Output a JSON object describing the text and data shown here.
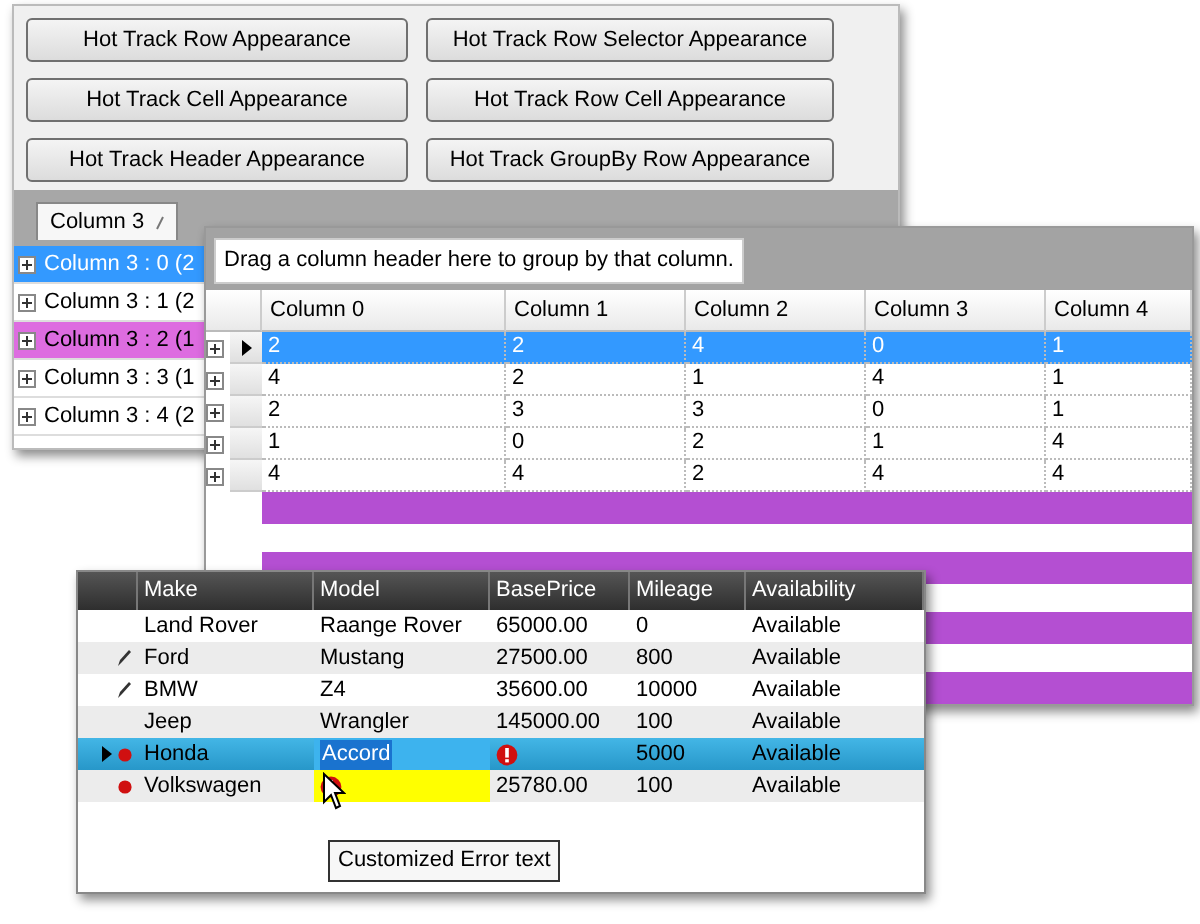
{
  "button_panel": {
    "buttons": [
      "Hot Track Row Appearance",
      "Hot Track Row Selector Appearance",
      "Hot Track Cell Appearance",
      "Hot Track Row Cell Appearance",
      "Hot Track Header Appearance",
      "Hot Track GroupBy Row Appearance"
    ]
  },
  "group_panel": {
    "group_chip": "Column 3",
    "group_rows": [
      {
        "text": "Column 3 : 0 (2",
        "selected": true,
        "hot_tracked": false
      },
      {
        "text": "Column 3 : 1 (2",
        "selected": false,
        "hot_tracked": false
      },
      {
        "text": "Column 3 : 2 (1",
        "selected": false,
        "hot_tracked": true
      },
      {
        "text": "Column 3 : 3 (1",
        "selected": false,
        "hot_tracked": false
      },
      {
        "text": "Column 3 : 4 (2",
        "selected": false,
        "hot_tracked": false
      }
    ]
  },
  "grid": {
    "prompt": "Drag a column header here to group by that column.",
    "columns": [
      "Column 0",
      "Column 1",
      "Column 2",
      "Column 3",
      "Column 4"
    ],
    "rows": [
      {
        "current": true,
        "selected": true,
        "cells": [
          "2",
          "2",
          "4",
          "0",
          "1"
        ]
      },
      {
        "current": false,
        "selected": false,
        "cells": [
          "4",
          "2",
          "1",
          "4",
          "1"
        ]
      },
      {
        "current": false,
        "selected": false,
        "cells": [
          "2",
          "3",
          "3",
          "0",
          "1"
        ]
      },
      {
        "current": false,
        "selected": false,
        "cells": [
          "1",
          "0",
          "2",
          "1",
          "4"
        ]
      },
      {
        "current": false,
        "selected": false,
        "cells": [
          "4",
          "4",
          "2",
          "4",
          "4"
        ]
      }
    ]
  },
  "cars_grid": {
    "columns": [
      "Make",
      "Model",
      "BasePrice",
      "Mileage",
      "Availability"
    ],
    "rows": [
      {
        "current": false,
        "editing": false,
        "error": false,
        "selected": false,
        "cells": [
          {
            "kind": "text",
            "text": "Land Rover"
          },
          {
            "kind": "text",
            "text": "Raange Rover"
          },
          {
            "kind": "text",
            "text": "65000.00"
          },
          {
            "kind": "text",
            "text": "0"
          },
          {
            "kind": "text",
            "text": "Available"
          }
        ]
      },
      {
        "current": false,
        "editing": true,
        "error": false,
        "selected": false,
        "cells": [
          {
            "kind": "text",
            "text": "Ford"
          },
          {
            "kind": "text",
            "text": "Mustang"
          },
          {
            "kind": "text",
            "text": "27500.00"
          },
          {
            "kind": "text",
            "text": "800"
          },
          {
            "kind": "text",
            "text": "Available"
          }
        ]
      },
      {
        "current": false,
        "editing": true,
        "error": false,
        "selected": false,
        "cells": [
          {
            "kind": "text",
            "text": "BMW"
          },
          {
            "kind": "text",
            "text": "Z4"
          },
          {
            "kind": "text",
            "text": "35600.00"
          },
          {
            "kind": "text",
            "text": "10000"
          },
          {
            "kind": "text",
            "text": "Available"
          }
        ]
      },
      {
        "current": false,
        "editing": false,
        "error": false,
        "selected": false,
        "cells": [
          {
            "kind": "text",
            "text": "Jeep"
          },
          {
            "kind": "text",
            "text": "Wrangler"
          },
          {
            "kind": "text",
            "text": "145000.00"
          },
          {
            "kind": "text",
            "text": "100"
          },
          {
            "kind": "text",
            "text": "Available"
          }
        ]
      },
      {
        "current": true,
        "editing": false,
        "error": true,
        "selected": true,
        "cells": [
          {
            "kind": "text",
            "text": "Honda"
          },
          {
            "kind": "editing",
            "text": "Accord"
          },
          {
            "kind": "error"
          },
          {
            "kind": "text",
            "text": "5000"
          },
          {
            "kind": "text",
            "text": "Available"
          }
        ]
      },
      {
        "current": false,
        "editing": false,
        "error": true,
        "selected": false,
        "cells": [
          {
            "kind": "text",
            "text": "Volkswagen"
          },
          {
            "kind": "error-highlight"
          },
          {
            "kind": "text",
            "text": "25780.00"
          },
          {
            "kind": "text",
            "text": "100"
          },
          {
            "kind": "text",
            "text": "Available"
          }
        ]
      }
    ]
  },
  "tooltip": "Customized Error text"
}
